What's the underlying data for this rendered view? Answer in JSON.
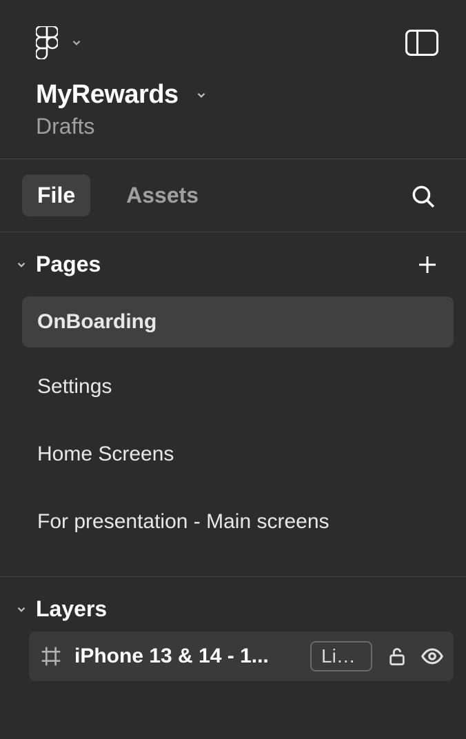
{
  "project": {
    "title": "MyRewards",
    "location": "Drafts"
  },
  "tabs": {
    "file": "File",
    "assets": "Assets",
    "active": "file"
  },
  "pages": {
    "section_title": "Pages",
    "items": [
      {
        "label": "OnBoarding",
        "selected": true
      },
      {
        "label": "Settings",
        "selected": false
      },
      {
        "label": "Home Screens",
        "selected": false
      },
      {
        "label": "For presentation - Main screens",
        "selected": false
      }
    ]
  },
  "layers": {
    "section_title": "Layers",
    "item": {
      "name": "iPhone 13 & 14 - 1...",
      "variant": "Lig..."
    }
  }
}
